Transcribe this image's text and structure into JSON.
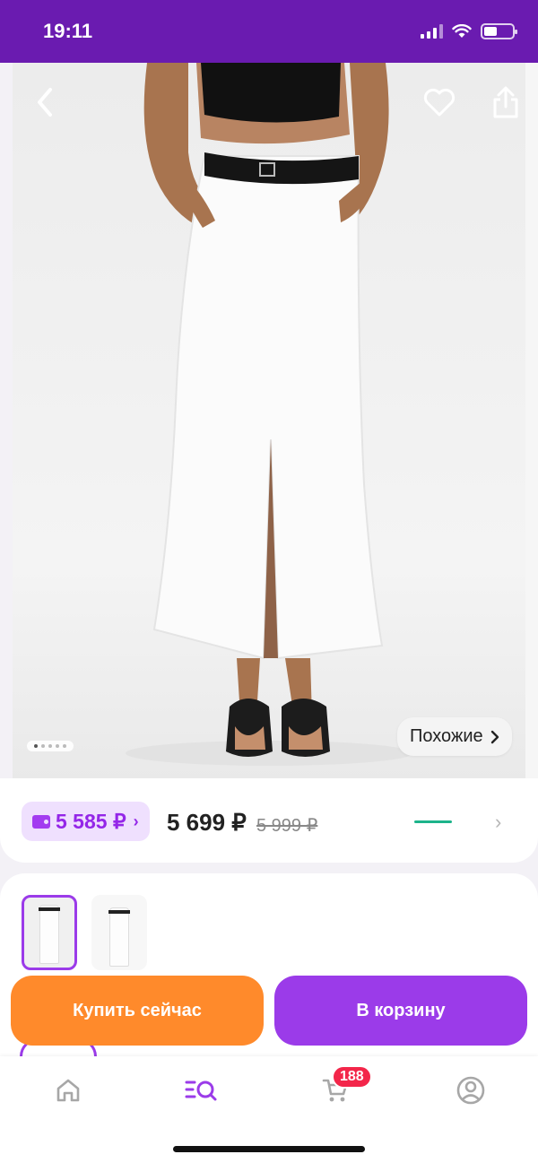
{
  "status_bar": {
    "time": "19:11"
  },
  "photo": {
    "similar_label": "Похожие",
    "gallery_dots": 5,
    "active_dot": 0
  },
  "price": {
    "wallet_price": "5 585 ₽",
    "current": "5 699 ₽",
    "old": "5 999 ₽"
  },
  "variants": {
    "count": 2,
    "selected": 0
  },
  "actions": {
    "buy_now": "Купить сейчас",
    "add_to_cart": "В корзину"
  },
  "nav": {
    "cart_badge": "188",
    "active": "catalog",
    "accent": "#9b3be9"
  },
  "colors": {
    "brand": "#6a1bb0",
    "buy_button": "#ff8a2b",
    "cart_button": "#9b3be9",
    "badge": "#f3264a",
    "wallet_text": "#9426e8"
  }
}
